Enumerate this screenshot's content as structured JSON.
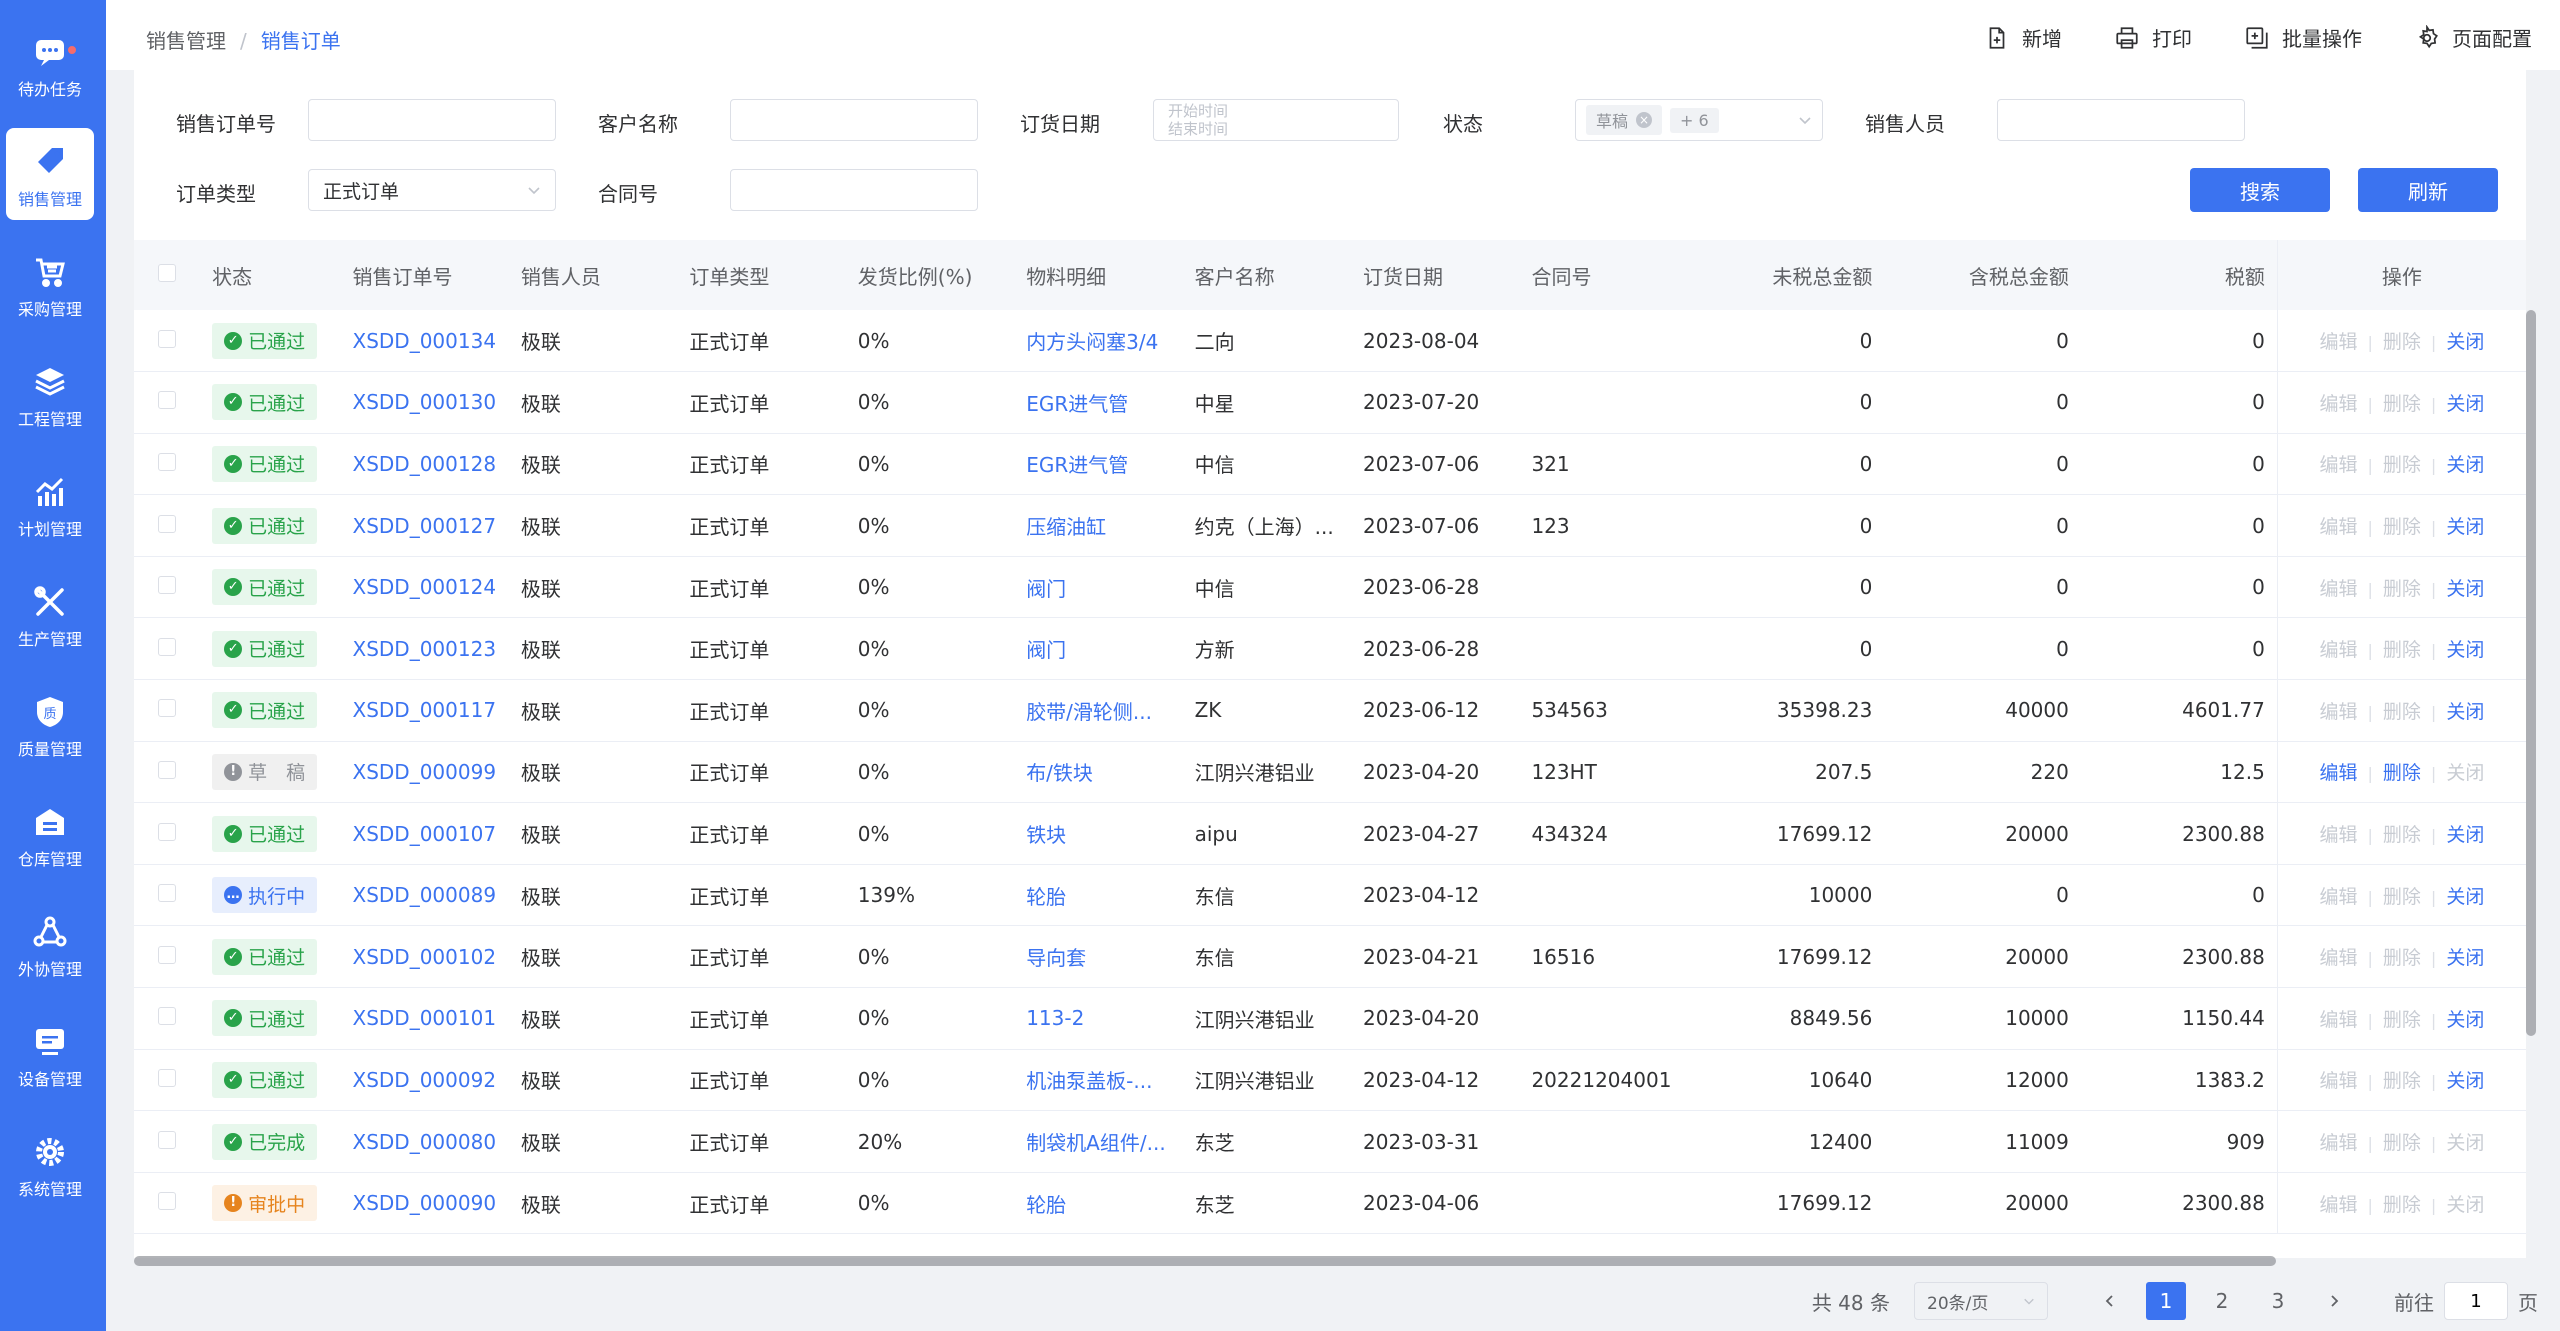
{
  "sidebar": {
    "items": [
      {
        "label": "待办任务",
        "icon": "chat-icon"
      },
      {
        "label": "销售管理",
        "icon": "tag-icon"
      },
      {
        "label": "采购管理",
        "icon": "cart-icon"
      },
      {
        "label": "工程管理",
        "icon": "layers-icon"
      },
      {
        "label": "计划管理",
        "icon": "chart-icon"
      },
      {
        "label": "生产管理",
        "icon": "tools-icon"
      },
      {
        "label": "质量管理",
        "icon": "shield-icon"
      },
      {
        "label": "仓库管理",
        "icon": "warehouse-icon"
      },
      {
        "label": "外协管理",
        "icon": "network-icon"
      },
      {
        "label": "设备管理",
        "icon": "monitor-icon"
      },
      {
        "label": "系统管理",
        "icon": "gear-icon"
      }
    ],
    "active_index": 1
  },
  "breadcrumb": {
    "parent": "销售管理",
    "current": "销售订单"
  },
  "top_actions": {
    "add": "新增",
    "print": "打印",
    "batch": "批量操作",
    "config": "页面配置"
  },
  "filters": {
    "order_no_label": "销售订单号",
    "customer_label": "客户名称",
    "order_date_label": "订货日期",
    "date_start_placeholder": "开始时间",
    "date_end_placeholder": "结束时间",
    "status_label": "状态",
    "status_tag": "草稿",
    "status_more": "+ 6",
    "salesperson_label": "销售人员",
    "order_type_label": "订单类型",
    "order_type_value": "正式订单",
    "contract_label": "合同号",
    "search_btn": "搜索",
    "refresh_btn": "刷新"
  },
  "table": {
    "headers": {
      "status": "状态",
      "order_no": "销售订单号",
      "salesperson": "销售人员",
      "order_type": "订单类型",
      "ship_ratio": "发货比例(%)",
      "material": "物料明细",
      "customer": "客户名称",
      "date": "订货日期",
      "contract": "合同号",
      "net": "未税总金额",
      "gross": "含税总金额",
      "tax": "税额",
      "ops": "操作"
    },
    "ops": {
      "edit": "编辑",
      "delete": "删除",
      "close": "关闭"
    },
    "rows": [
      {
        "status": "已通过",
        "st": "pass",
        "icon": "✓",
        "order_no": "XSDD_000134",
        "salesperson": "极联",
        "order_type": "正式订单",
        "ship_ratio": "0%",
        "material": "内方头闷塞3/4",
        "customer": "二向",
        "date": "2023-08-04",
        "contract": "",
        "net": "0",
        "gross": "0",
        "tax": "0",
        "edit": false,
        "del": false,
        "close": true
      },
      {
        "status": "已通过",
        "st": "pass",
        "icon": "✓",
        "order_no": "XSDD_000130",
        "salesperson": "极联",
        "order_type": "正式订单",
        "ship_ratio": "0%",
        "material": "EGR进气管",
        "customer": "中星",
        "date": "2023-07-20",
        "contract": "",
        "net": "0",
        "gross": "0",
        "tax": "0",
        "edit": false,
        "del": false,
        "close": true
      },
      {
        "status": "已通过",
        "st": "pass",
        "icon": "✓",
        "order_no": "XSDD_000128",
        "salesperson": "极联",
        "order_type": "正式订单",
        "ship_ratio": "0%",
        "material": "EGR进气管",
        "customer": "中信",
        "date": "2023-07-06",
        "contract": "321",
        "net": "0",
        "gross": "0",
        "tax": "0",
        "edit": false,
        "del": false,
        "close": true
      },
      {
        "status": "已通过",
        "st": "pass",
        "icon": "✓",
        "order_no": "XSDD_000127",
        "salesperson": "极联",
        "order_type": "正式订单",
        "ship_ratio": "0%",
        "material": "压缩油缸",
        "customer": "约克（上海）...",
        "date": "2023-07-06",
        "contract": "123",
        "net": "0",
        "gross": "0",
        "tax": "0",
        "edit": false,
        "del": false,
        "close": true
      },
      {
        "status": "已通过",
        "st": "pass",
        "icon": "✓",
        "order_no": "XSDD_000124",
        "salesperson": "极联",
        "order_type": "正式订单",
        "ship_ratio": "0%",
        "material": "阀门",
        "customer": "中信",
        "date": "2023-06-28",
        "contract": "",
        "net": "0",
        "gross": "0",
        "tax": "0",
        "edit": false,
        "del": false,
        "close": true
      },
      {
        "status": "已通过",
        "st": "pass",
        "icon": "✓",
        "order_no": "XSDD_000123",
        "salesperson": "极联",
        "order_type": "正式订单",
        "ship_ratio": "0%",
        "material": "阀门",
        "customer": "方新",
        "date": "2023-06-28",
        "contract": "",
        "net": "0",
        "gross": "0",
        "tax": "0",
        "edit": false,
        "del": false,
        "close": true
      },
      {
        "status": "已通过",
        "st": "pass",
        "icon": "✓",
        "order_no": "XSDD_000117",
        "salesperson": "极联",
        "order_type": "正式订单",
        "ship_ratio": "0%",
        "material": "胶带/滑轮侧...",
        "customer": "ZK",
        "date": "2023-06-12",
        "contract": "534563",
        "net": "35398.23",
        "gross": "40000",
        "tax": "4601.77",
        "edit": false,
        "del": false,
        "close": true
      },
      {
        "status": "草　稿",
        "st": "draft",
        "icon": "!",
        "order_no": "XSDD_000099",
        "salesperson": "极联",
        "order_type": "正式订单",
        "ship_ratio": "0%",
        "material": "布/铁块",
        "customer": "江阴兴港铝业",
        "date": "2023-04-20",
        "contract": "123HT",
        "net": "207.5",
        "gross": "220",
        "tax": "12.5",
        "edit": true,
        "del": true,
        "close": false
      },
      {
        "status": "已通过",
        "st": "pass",
        "icon": "✓",
        "order_no": "XSDD_000107",
        "salesperson": "极联",
        "order_type": "正式订单",
        "ship_ratio": "0%",
        "material": "铁块",
        "customer": "aipu",
        "date": "2023-04-27",
        "contract": "434324",
        "net": "17699.12",
        "gross": "20000",
        "tax": "2300.88",
        "edit": false,
        "del": false,
        "close": true
      },
      {
        "status": "执行中",
        "st": "run",
        "icon": "…",
        "order_no": "XSDD_000089",
        "salesperson": "极联",
        "order_type": "正式订单",
        "ship_ratio": "139%",
        "material": "轮胎",
        "customer": "东信",
        "date": "2023-04-12",
        "contract": "",
        "net": "10000",
        "gross": "0",
        "tax": "0",
        "edit": false,
        "del": false,
        "close": true
      },
      {
        "status": "已通过",
        "st": "pass",
        "icon": "✓",
        "order_no": "XSDD_000102",
        "salesperson": "极联",
        "order_type": "正式订单",
        "ship_ratio": "0%",
        "material": "导向套",
        "customer": "东信",
        "date": "2023-04-21",
        "contract": "16516",
        "net": "17699.12",
        "gross": "20000",
        "tax": "2300.88",
        "edit": false,
        "del": false,
        "close": true
      },
      {
        "status": "已通过",
        "st": "pass",
        "icon": "✓",
        "order_no": "XSDD_000101",
        "salesperson": "极联",
        "order_type": "正式订单",
        "ship_ratio": "0%",
        "material": "113-2",
        "customer": "江阴兴港铝业",
        "date": "2023-04-20",
        "contract": "",
        "net": "8849.56",
        "gross": "10000",
        "tax": "1150.44",
        "edit": false,
        "del": false,
        "close": true
      },
      {
        "status": "已通过",
        "st": "pass",
        "icon": "✓",
        "order_no": "XSDD_000092",
        "salesperson": "极联",
        "order_type": "正式订单",
        "ship_ratio": "0%",
        "material": "机油泵盖板-...",
        "customer": "江阴兴港铝业",
        "date": "2023-04-12",
        "contract": "20221204001",
        "net": "10640",
        "gross": "12000",
        "tax": "1383.2",
        "edit": false,
        "del": false,
        "close": true
      },
      {
        "status": "已完成",
        "st": "done",
        "icon": "✓",
        "order_no": "XSDD_000080",
        "salesperson": "极联",
        "order_type": "正式订单",
        "ship_ratio": "20%",
        "material": "制袋机A组件/...",
        "customer": "东芝",
        "date": "2023-03-31",
        "contract": "",
        "net": "12400",
        "gross": "11009",
        "tax": "909",
        "edit": false,
        "del": false,
        "close": false
      },
      {
        "status": "审批中",
        "st": "review",
        "icon": "!",
        "order_no": "XSDD_000090",
        "salesperson": "极联",
        "order_type": "正式订单",
        "ship_ratio": "0%",
        "material": "轮胎",
        "customer": "东芝",
        "date": "2023-04-06",
        "contract": "",
        "net": "17699.12",
        "gross": "20000",
        "tax": "2300.88",
        "edit": false,
        "del": false,
        "close": false
      }
    ]
  },
  "pagination": {
    "total": "共 48 条",
    "page_size": "20条/页",
    "pages": [
      "1",
      "2",
      "3"
    ],
    "current": "1",
    "goto_label": "前往",
    "goto_value": "1",
    "page_suffix": "页"
  }
}
